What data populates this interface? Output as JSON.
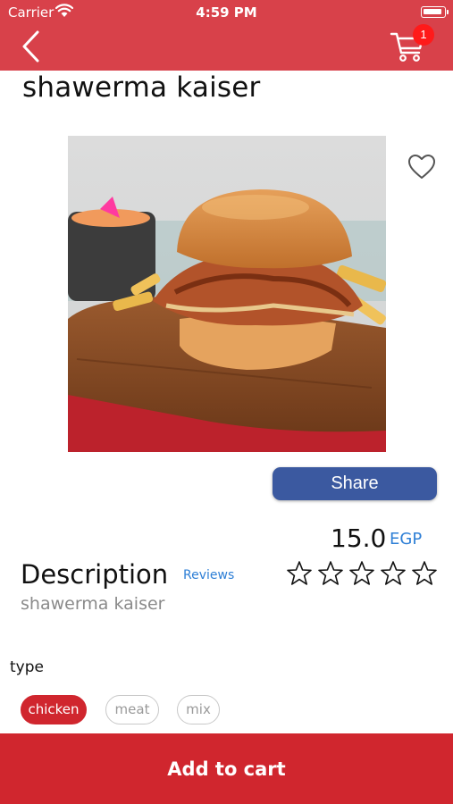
{
  "status_bar": {
    "carrier": "Carrier",
    "time": "4:59 PM"
  },
  "header": {
    "back_icon": "chevron-left-icon",
    "cart_icon": "cart-icon",
    "cart_count": "1"
  },
  "product": {
    "name": "shawerma kaiser",
    "image_alt": "shawerma kaiser",
    "share_label": "Share",
    "price": "15.0",
    "currency": "EGP",
    "description_heading": "Description",
    "reviews_label": "Reviews",
    "description": "shawerma kaiser",
    "rating": 0,
    "rating_max": 5
  },
  "options": {
    "label": "type",
    "items": [
      {
        "label": "chicken",
        "selected": true
      },
      {
        "label": "meat",
        "selected": false
      },
      {
        "label": "mix",
        "selected": false
      }
    ]
  },
  "footer": {
    "add_to_cart_label": "Add to cart"
  },
  "colors": {
    "header_bg": "#d8414a",
    "accent_red": "#d0262e",
    "share_blue": "#3b59a0",
    "link_blue": "#2e7fd6",
    "badge_red": "#ff1a1a"
  }
}
